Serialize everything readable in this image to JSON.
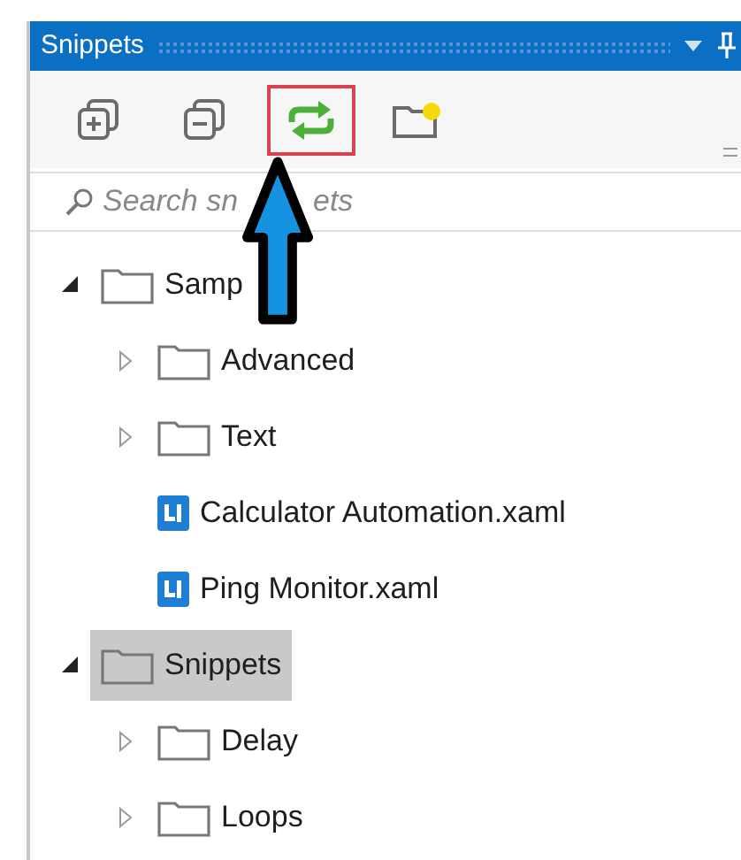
{
  "panel": {
    "title": "Snippets"
  },
  "toolbar": [
    {
      "kind": "expand",
      "highlighted": false
    },
    {
      "kind": "collapse",
      "highlighted": false
    },
    {
      "kind": "refresh",
      "highlighted": true
    },
    {
      "kind": "add-folder",
      "highlighted": false
    }
  ],
  "search": {
    "placeholder": "Search sn",
    "visible_tail": "ets"
  },
  "tree": [
    {
      "label": "Samp",
      "kind": "folder",
      "expanded": true,
      "selected": false,
      "children": [
        {
          "label": "Advanced",
          "kind": "folder",
          "expanded": false,
          "selected": false
        },
        {
          "label": "Text",
          "kind": "folder",
          "expanded": false,
          "selected": false
        },
        {
          "label": "Calculator Automation.xaml",
          "kind": "file",
          "selected": false
        },
        {
          "label": "Ping Monitor.xaml",
          "kind": "file",
          "selected": false
        }
      ]
    },
    {
      "label": "Snippets",
      "kind": "folder",
      "expanded": true,
      "selected": true,
      "children": [
        {
          "label": "Delay",
          "kind": "folder",
          "expanded": false,
          "selected": false
        },
        {
          "label": "Loops",
          "kind": "folder",
          "expanded": false,
          "selected": false
        }
      ]
    }
  ]
}
